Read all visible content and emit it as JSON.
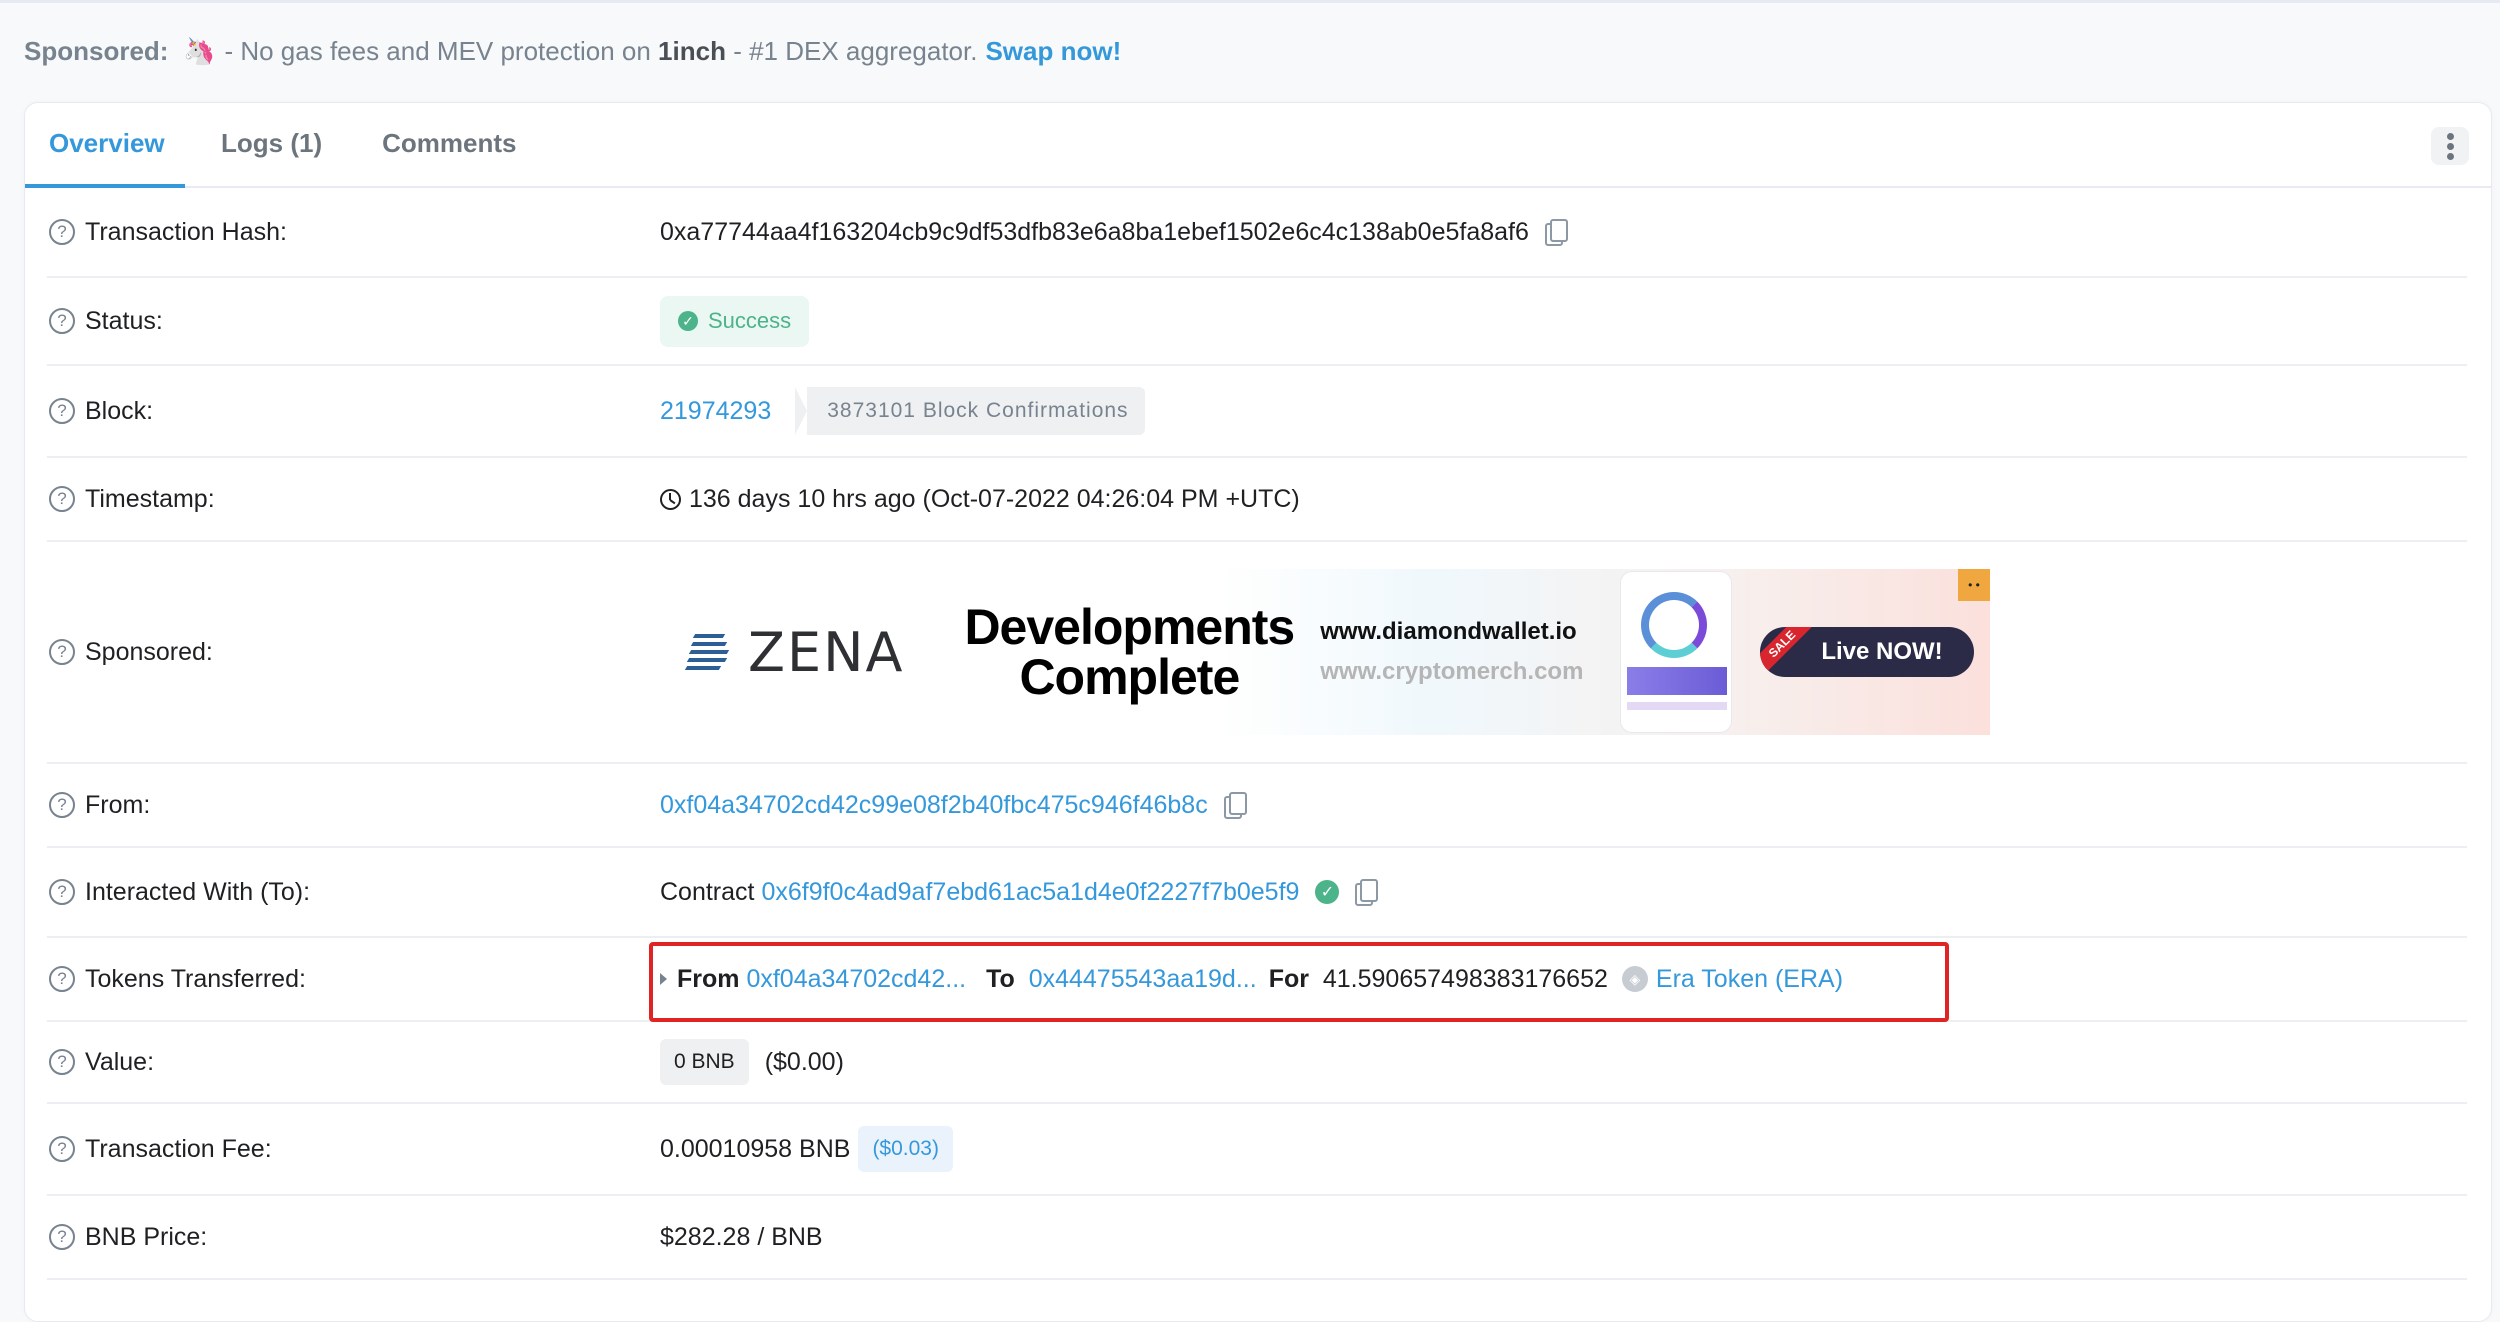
{
  "sponsored_top": {
    "label": "Sponsored:",
    "icon": "unicorn-icon",
    "text_pre": "- No gas fees and MEV protection on",
    "brand": "1inch",
    "text_post": "- #1 DEX aggregator.",
    "cta": "Swap now!"
  },
  "tabs": [
    {
      "label": "Overview",
      "active": true
    },
    {
      "label": "Logs (1)",
      "active": false
    },
    {
      "label": "Comments",
      "active": false
    }
  ],
  "more_menu_icon": "vertical-ellipsis-icon",
  "rows": {
    "tx_hash": {
      "label": "Transaction Hash:",
      "value": "0xa77744aa4f163204cb9c9df53dfb83e6a8ba1ebef1502e6c4c138ab0e5fa8af6"
    },
    "status": {
      "label": "Status:",
      "value": "Success"
    },
    "block": {
      "label": "Block:",
      "value": "21974293",
      "confirmations": "3873101 Block Confirmations"
    },
    "timestamp": {
      "label": "Timestamp:",
      "value": "136 days 10 hrs ago (Oct-07-2022 04:26:04 PM +UTC)"
    },
    "sponsored": {
      "label": "Sponsored:",
      "ad": {
        "brand": "ZENA",
        "headline_1": "Developments",
        "headline_2": "Complete",
        "url_1": "www.diamondwallet.io",
        "url_2": "www.cryptomerch.com",
        "sale_tag": "SALE",
        "cta": "Live NOW!"
      }
    },
    "from": {
      "label": "From:",
      "value": "0xf04a34702cd42c99e08f2b40fbc475c946f46b8c"
    },
    "interacted_with": {
      "label": "Interacted With (To):",
      "prefix": "Contract",
      "value": "0x6f9f0c4ad9af7ebd61ac5a1d4e0f2227f7b0e5f9"
    },
    "tokens_transferred": {
      "label": "Tokens Transferred:",
      "from_label": "From",
      "from_value": "0xf04a34702cd42...",
      "to_label": "To",
      "to_value": "0x44475543aa19d...",
      "for_label": "For",
      "amount": "41.590657498383176652",
      "token": "Era Token (ERA)",
      "highlight_color": "#e02424"
    },
    "value": {
      "label": "Value:",
      "amount": "0 BNB",
      "usd": "($0.00)"
    },
    "tx_fee": {
      "label": "Transaction Fee:",
      "amount": "0.00010958 BNB",
      "usd": "($0.03)"
    },
    "bnb_price": {
      "label": "BNB Price:",
      "value": "$282.28 / BNB"
    }
  },
  "colors": {
    "accent": "#3498db",
    "success": "#4cb38a",
    "highlight": "#e02424"
  }
}
